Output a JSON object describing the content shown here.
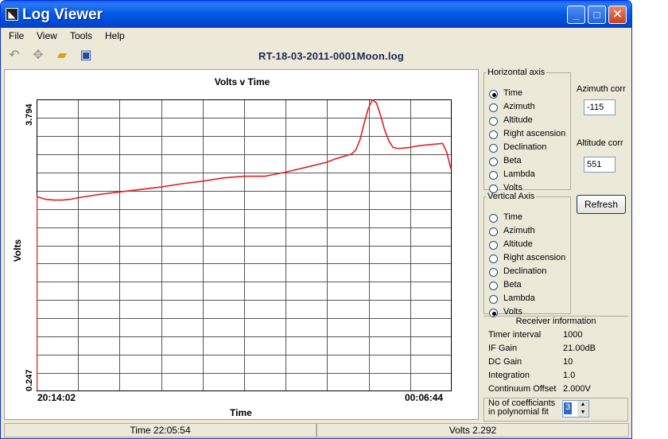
{
  "window": {
    "title": "Log Viewer"
  },
  "menu": [
    "File",
    "View",
    "Tools",
    "Help"
  ],
  "toolbar": {
    "filename": "RT-18-03-2011-0001Moon.log"
  },
  "chart_data": {
    "type": "line",
    "title": "Volts v Time",
    "xlabel": "Time",
    "ylabel": "Volts",
    "ylim": [
      0.247,
      3.794
    ],
    "x_tick_labels": [
      "20:14:02",
      "00:06:44"
    ],
    "y_tick_labels": [
      "3.794",
      "0.247"
    ],
    "grid": true,
    "series": [
      {
        "color": "#e02020",
        "x": [
          0,
          0.02,
          0.04,
          0.06,
          0.08,
          0.1,
          0.15,
          0.2,
          0.25,
          0.3,
          0.35,
          0.4,
          0.45,
          0.5,
          0.55,
          0.6,
          0.65,
          0.7,
          0.72,
          0.74,
          0.76,
          0.77,
          0.78,
          0.79,
          0.8,
          0.81,
          0.82,
          0.83,
          0.84,
          0.85,
          0.86,
          0.87,
          0.88,
          0.9,
          0.92,
          0.94,
          0.96,
          0.98,
          0.99,
          1.0
        ],
        "y": [
          2.61,
          2.58,
          2.57,
          2.57,
          2.58,
          2.6,
          2.64,
          2.67,
          2.7,
          2.73,
          2.77,
          2.8,
          2.84,
          2.86,
          2.86,
          2.91,
          2.97,
          3.03,
          3.07,
          3.1,
          3.13,
          3.18,
          3.3,
          3.5,
          3.68,
          3.79,
          3.75,
          3.6,
          3.42,
          3.29,
          3.21,
          3.2,
          3.2,
          3.21,
          3.23,
          3.24,
          3.25,
          3.26,
          3.15,
          2.95
        ]
      }
    ]
  },
  "horizontal_axis": {
    "title": "Horizontal axis",
    "options": [
      "Time",
      "Azimuth",
      "Altitude",
      "Right ascension",
      "Declination",
      "Beta",
      "Lambda",
      "Volts"
    ],
    "selected": "Time"
  },
  "vertical_axis": {
    "title": "Vertical Axis",
    "options": [
      "Time",
      "Azimuth",
      "Altitude",
      "Right ascension",
      "Declination",
      "Beta",
      "Lambda",
      "Volts"
    ],
    "selected": "Volts"
  },
  "corrections": {
    "azimuth_label": "Azimuth corr",
    "azimuth_value": "-115",
    "altitude_label": "Altitude corr",
    "altitude_value": "551",
    "refresh_label": "Refresh"
  },
  "receiver": {
    "title": "Receiver information",
    "rows": [
      {
        "key": "Timer interval",
        "value": "1000"
      },
      {
        "key": "IF Gain",
        "value": "21.00dB"
      },
      {
        "key": "DC Gain",
        "value": "10"
      },
      {
        "key": "Integration",
        "value": "1.0"
      },
      {
        "key": "Continuum Offset",
        "value": "2.000V"
      }
    ]
  },
  "polyfit": {
    "label_line1": "No of coefficiants",
    "label_line2": "in polynomial fit",
    "value": "3"
  },
  "status": {
    "time": "Time 22:05:54",
    "volts": "Volts 2.292"
  }
}
